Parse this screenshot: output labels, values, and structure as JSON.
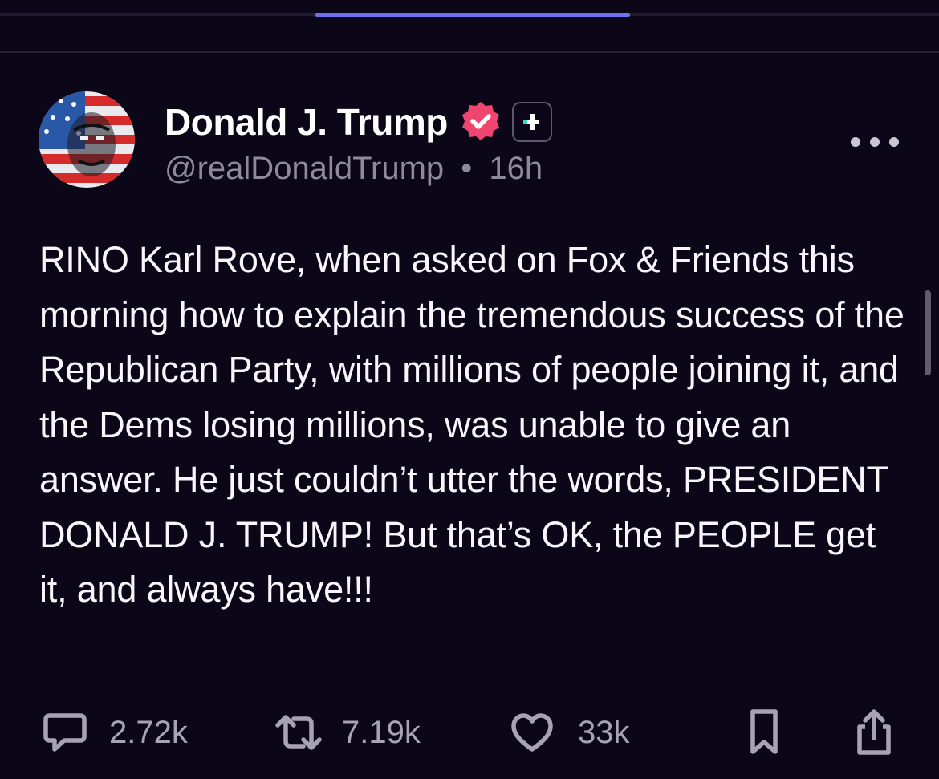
{
  "tabs": {
    "active_index": 1
  },
  "post": {
    "author": {
      "display_name": "Donald J. Trump",
      "handle": "@realDonaldTrump",
      "verified_icon": "verified-badge-icon",
      "plus_icon": "plus-badge-icon"
    },
    "separator": "•",
    "time": "16h",
    "text": "RINO Karl Rove, when asked on Fox & Friends this morning how to explain the tremendous success of the Republican Party, with millions of people joining it, and the Dems losing millions, was unable to give an answer. He just couldn’t utter the words, PRESIDENT DONALD J. TRUMP! But that’s OK, the PEOPLE get it, and always have!!!",
    "actions": {
      "replies": "2.72k",
      "reposts": "7.19k",
      "likes": "33k"
    }
  },
  "colors": {
    "background": "#0b0719",
    "tab_accent": "#7370ee",
    "verified_badge": "#f0456e",
    "plus_accent": "#38d9c0",
    "muted_text": "#8d8a9c"
  }
}
